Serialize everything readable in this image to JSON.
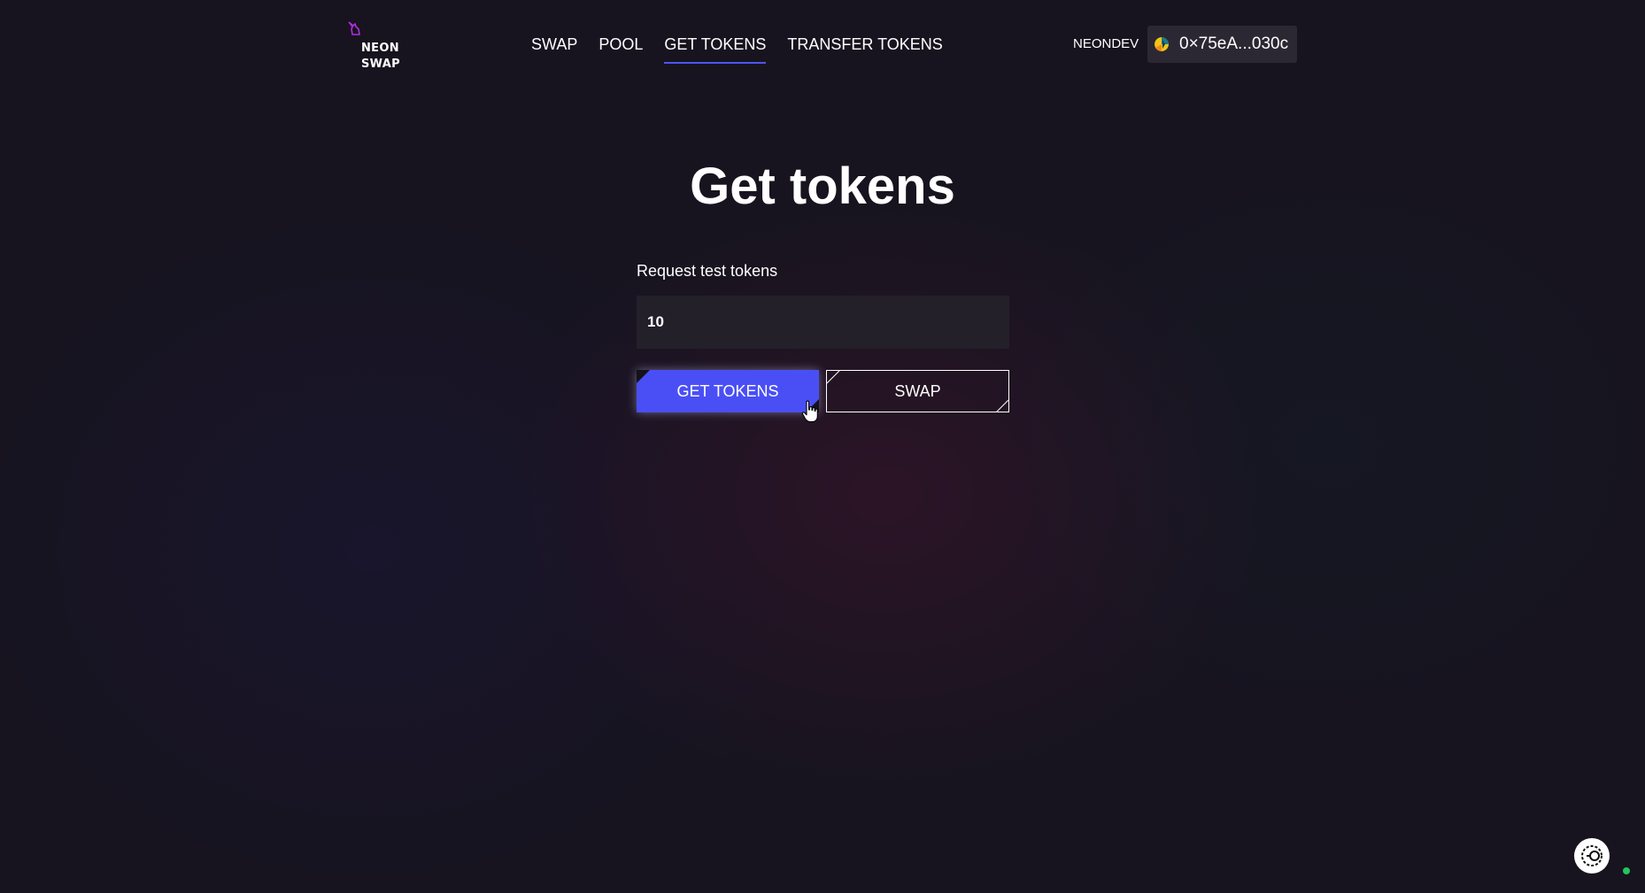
{
  "header": {
    "logo": {
      "icon": "unicorn-icon",
      "line1": "NEON",
      "line2": "SWAP"
    },
    "nav": [
      {
        "label": "SWAP",
        "active": false
      },
      {
        "label": "POOL",
        "active": false
      },
      {
        "label": "GET TOKENS",
        "active": true
      },
      {
        "label": "TRANSFER TOKENS",
        "active": false
      }
    ],
    "network": "NEONDEV",
    "wallet": {
      "address": "0×75eA...030c",
      "avatar": "wallet-avatar-icon"
    }
  },
  "main": {
    "title": "Get tokens",
    "form": {
      "label": "Request test tokens",
      "amount_value": "10"
    },
    "buttons": {
      "get_tokens": "GET TOKENS",
      "swap": "SWAP"
    }
  },
  "widget": {
    "icon": "support-chat-icon",
    "status": "online"
  },
  "colors": {
    "background": "#17141f",
    "accent": "#4a4ff5",
    "input_background": "#23202a",
    "wallet_background": "#2b2833",
    "logo": "#b32de0",
    "status": "#22c55e"
  }
}
